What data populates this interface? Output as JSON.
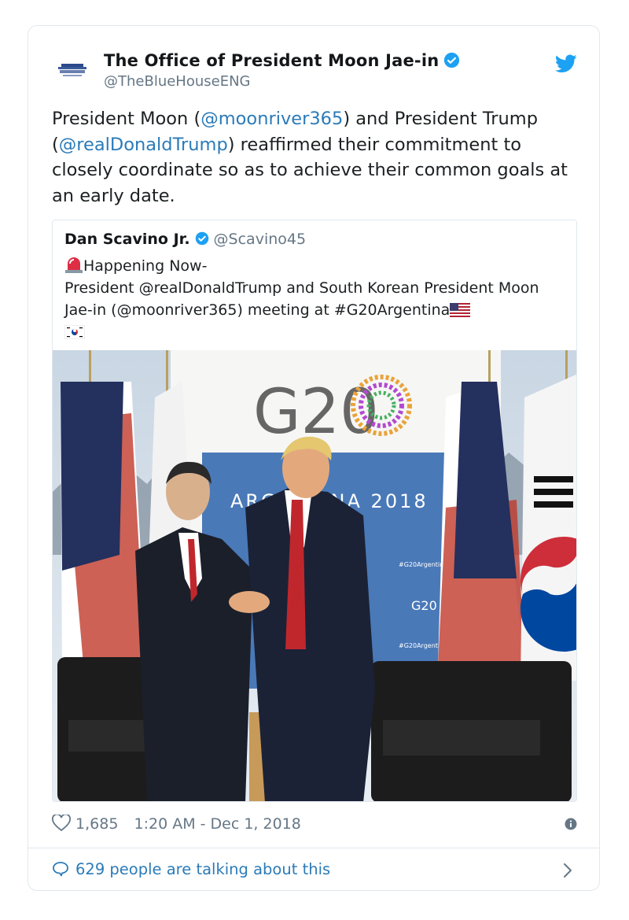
{
  "tweet": {
    "author_name": "The Office of President Moon Jae-in",
    "author_handle": "@TheBlueHouseENG",
    "text_parts": [
      "President Moon (",
      "@moonriver365",
      ") and President Trump (",
      "@realDonaldTrump",
      ") reaffirmed their commitment to closely coordinate so as to achieve their common goals at an early date."
    ]
  },
  "quoted": {
    "author_name": "Dan Scavino Jr.",
    "author_handle": "@Scavino45",
    "line1": "Happening Now-",
    "line2": "President @realDonaldTrump and South Korean President Moon Jae-in (@moonriver365) meeting at #G20Argentina",
    "photo": {
      "logo": "G20",
      "banner": "ARGENTINA 2018",
      "small_tag": "#G20Argentina",
      "small_logo": "G20"
    }
  },
  "footer": {
    "likes": "1,685",
    "timestamp": "1:20 AM - Dec 1, 2018",
    "talking": "629 people are talking about this"
  },
  "icons": {
    "verified": "verified-badge-icon",
    "bird": "twitter-bird-icon",
    "heart": "heart-icon",
    "info": "info-icon",
    "bubble": "comment-bubble-icon",
    "chevron": "chevron-right-icon",
    "siren": "rotating-light-emoji",
    "flag_us": "us-flag-emoji",
    "flag_kr": "south-korea-flag-emoji"
  },
  "colors": {
    "link": "#2b7bb9",
    "verified": "#1da1f2",
    "muted": "#657786"
  }
}
